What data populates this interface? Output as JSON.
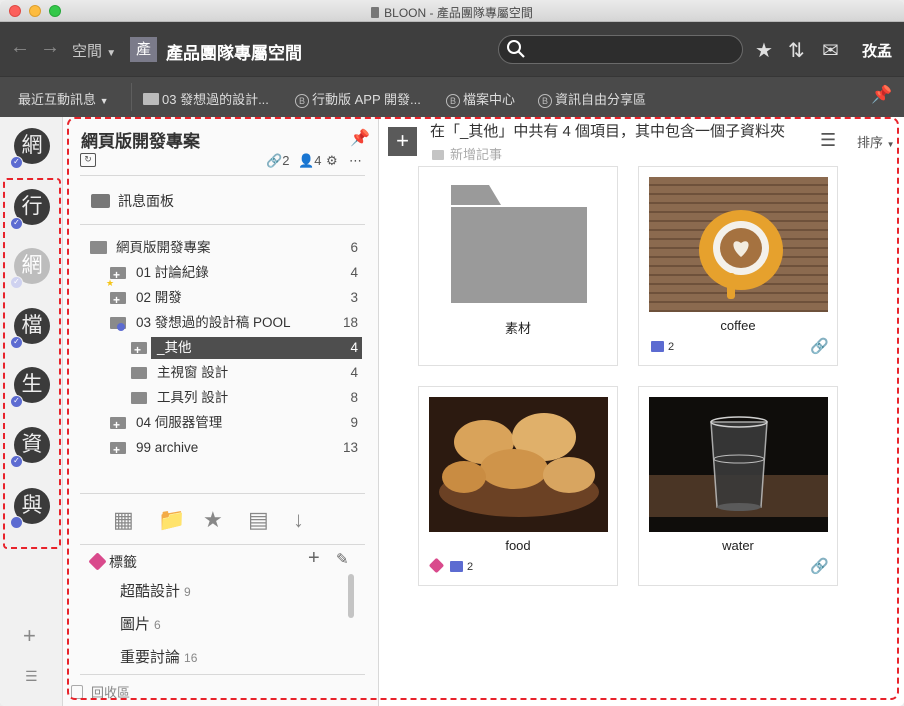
{
  "window": {
    "title": "BLOON - 產品團隊專屬空間"
  },
  "toolbar": {
    "space_menu": "空間",
    "space_badge": "產",
    "space_title": "產品團隊專屬空間",
    "search_placeholder": "",
    "user_name": "孜孟"
  },
  "favorites": {
    "recent": "最近互動訊息",
    "items": [
      {
        "label": "03 發想過的設計...",
        "icon": "folder-icon"
      },
      {
        "label": "行動版 APP 開發...",
        "icon": "b-circle-icon"
      },
      {
        "label": "檔案中心",
        "icon": "b-circle-icon"
      },
      {
        "label": "資訊自由分享區",
        "icon": "b-circle-icon"
      }
    ]
  },
  "rail": {
    "spaces": [
      {
        "label": "網",
        "state": "normal"
      },
      {
        "label": "行",
        "state": "normal"
      },
      {
        "label": "網",
        "state": "dim"
      },
      {
        "label": "檔",
        "state": "normal"
      },
      {
        "label": "生",
        "state": "normal"
      },
      {
        "label": "資",
        "state": "normal"
      },
      {
        "label": "與",
        "state": "normal"
      }
    ]
  },
  "project": {
    "title": "網頁版開發專案",
    "links": "2",
    "members": "4",
    "message_board": "訊息面板",
    "tree": [
      {
        "label": "網頁版開發專案",
        "count": "6",
        "level": 0
      },
      {
        "label": "01 討論紀錄",
        "count": "4",
        "level": 1
      },
      {
        "label": "02 開發",
        "count": "3",
        "level": 1
      },
      {
        "label": "03 發想過的設計稿 POOL",
        "count": "18",
        "level": 1
      },
      {
        "label": "_其他",
        "count": "4",
        "level": 2,
        "selected": true
      },
      {
        "label": "主視窗 設計",
        "count": "4",
        "level": 2
      },
      {
        "label": "工具列 設計",
        "count": "8",
        "level": 2
      },
      {
        "label": "04 伺服器管理",
        "count": "9",
        "level": 1
      },
      {
        "label": "99 archive",
        "count": "13",
        "level": 1
      }
    ],
    "tags_header": "標籤",
    "tags": [
      {
        "label": "超酷設計",
        "count": "9"
      },
      {
        "label": "圖片",
        "count": "6"
      },
      {
        "label": "重要討論",
        "count": "16"
      }
    ],
    "recycle": "回收區"
  },
  "content": {
    "summary": "在「_其他」中共有 4 個項目，其中包含一個子資料夾",
    "new_note": "新增記事",
    "sort_label": "排序",
    "cards": [
      {
        "name": "素材",
        "type": "folder"
      },
      {
        "name": "coffee",
        "type": "image",
        "comments": "2",
        "has_link": true
      },
      {
        "name": "food",
        "type": "image",
        "comments": "2",
        "has_tag": true
      },
      {
        "name": "water",
        "type": "image",
        "has_link": true
      }
    ]
  },
  "colors": {
    "toolbar": "#3e3e3e",
    "favbar": "#4a4a4a",
    "accent_blue": "#5c6bd1",
    "link_green": "#6ab04c",
    "tag_pink": "#d94a8c",
    "selection_dash": "#e8232b"
  }
}
